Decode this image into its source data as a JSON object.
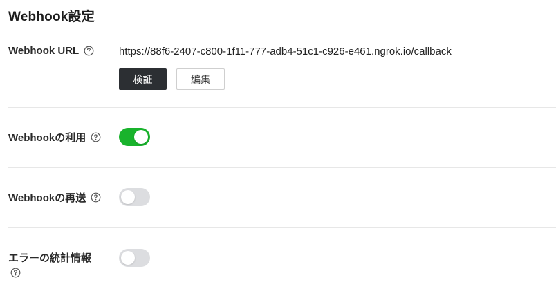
{
  "section_title": "Webhook設定",
  "colors": {
    "toggle_on": "#19b32c",
    "toggle_off": "#dcdde0",
    "primary_button": "#2c2f33"
  },
  "webhook_url": {
    "label": "Webhook URL",
    "help_icon": "question-circle-icon",
    "value": "https://88f6-2407-c800-1f11-777-adb4-51c1-c926-e461.ngrok.io/callback",
    "verify_button_label": "検証",
    "edit_button_label": "編集"
  },
  "use_webhook": {
    "label": "Webhookの利用",
    "help_icon": "question-circle-icon",
    "enabled": true
  },
  "redelivery": {
    "label": "Webhookの再送",
    "help_icon": "question-circle-icon",
    "enabled": false
  },
  "error_stats": {
    "label": "エラーの統計情報",
    "help_icon": "question-circle-icon",
    "enabled": false
  }
}
